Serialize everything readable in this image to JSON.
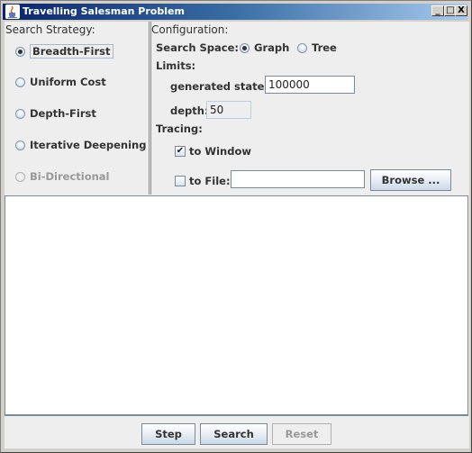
{
  "window": {
    "title": "Travelling Salesman Problem",
    "icon": "java-cup-icon",
    "controls": {
      "minimize": "_",
      "maximize": "□",
      "close": "X"
    }
  },
  "strategy": {
    "title": "Search Strategy:",
    "options": [
      {
        "label": "Breadth-First",
        "selected": true,
        "enabled": true
      },
      {
        "label": "Uniform Cost",
        "selected": false,
        "enabled": true
      },
      {
        "label": "Depth-First",
        "selected": false,
        "enabled": true
      },
      {
        "label": "Iterative Deepening",
        "selected": false,
        "enabled": true
      },
      {
        "label": "Bi-Directional",
        "selected": false,
        "enabled": false
      }
    ]
  },
  "config": {
    "title": "Configuration:",
    "search_space_label": "Search Space:",
    "search_space_options": [
      {
        "label": "Graph",
        "selected": true
      },
      {
        "label": "Tree",
        "selected": false
      }
    ],
    "limits_label": "Limits:",
    "generated_states_label": "generated states:",
    "generated_states_value": "100000",
    "depth_label": "depth:",
    "depth_value": "50",
    "tracing_label": "Tracing:",
    "to_window_label": "to Window",
    "to_window_checked": true,
    "to_file_label": "to File:",
    "to_file_checked": false,
    "file_path_value": "",
    "browse_label": "Browse ..."
  },
  "output": {
    "text": ""
  },
  "actions": {
    "step_label": "Step",
    "search_label": "Search",
    "reset_label": "Reset",
    "reset_enabled": false
  }
}
